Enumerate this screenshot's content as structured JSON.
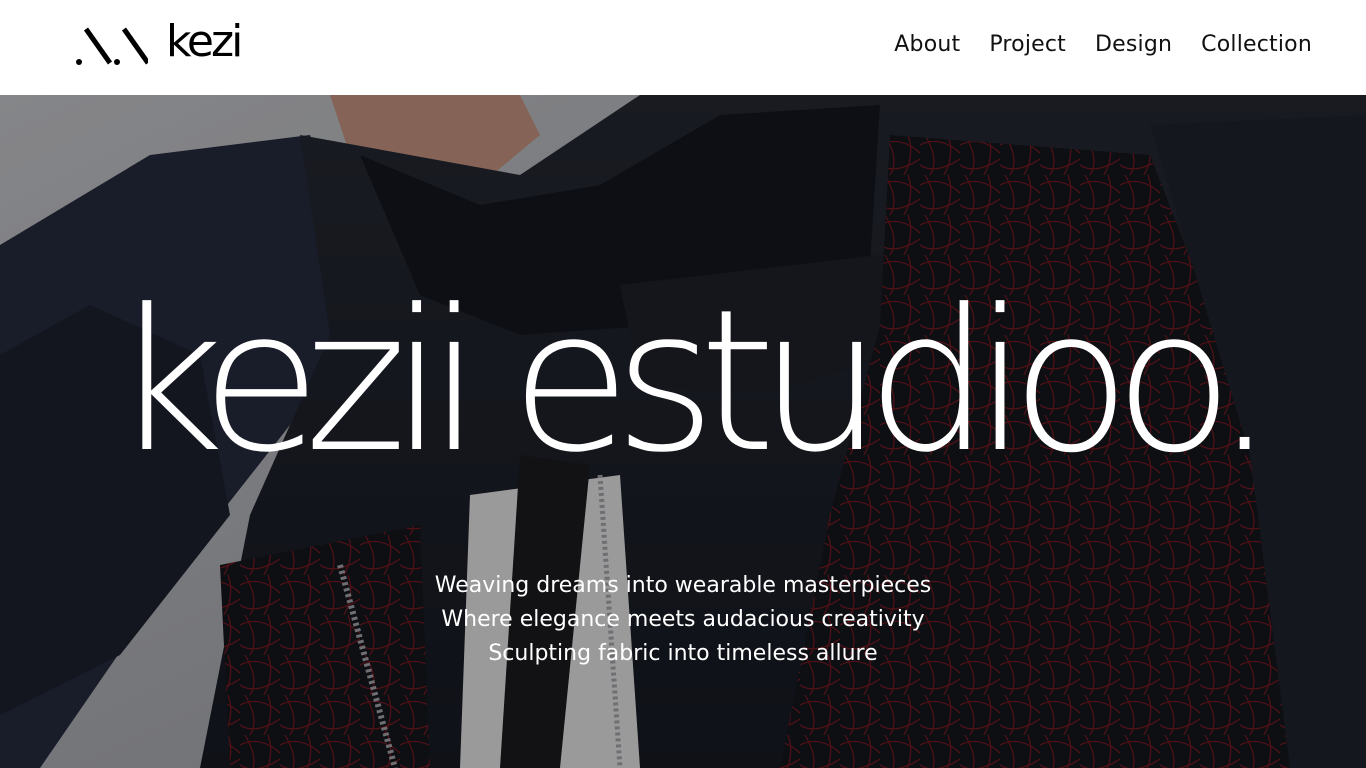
{
  "brand": {
    "logo_text": "kezi",
    "logo_mark_icon": "double-slash-logo-icon"
  },
  "nav": {
    "items": [
      {
        "label": "About"
      },
      {
        "label": "Project"
      },
      {
        "label": "Design"
      },
      {
        "label": "Collection"
      }
    ]
  },
  "hero": {
    "title": "kezii estudioo.",
    "taglines": [
      "Weaving dreams into wearable masterpieces",
      "Where elegance meets audacious creativity",
      "Sculpting fabric into timeless allure"
    ],
    "image_description_icon": "fashion-photo",
    "colors": {
      "overlay": "#1b1d24",
      "jacket": "#202430",
      "stitching": "#8a1a22",
      "background": "#c9c9cc"
    }
  }
}
